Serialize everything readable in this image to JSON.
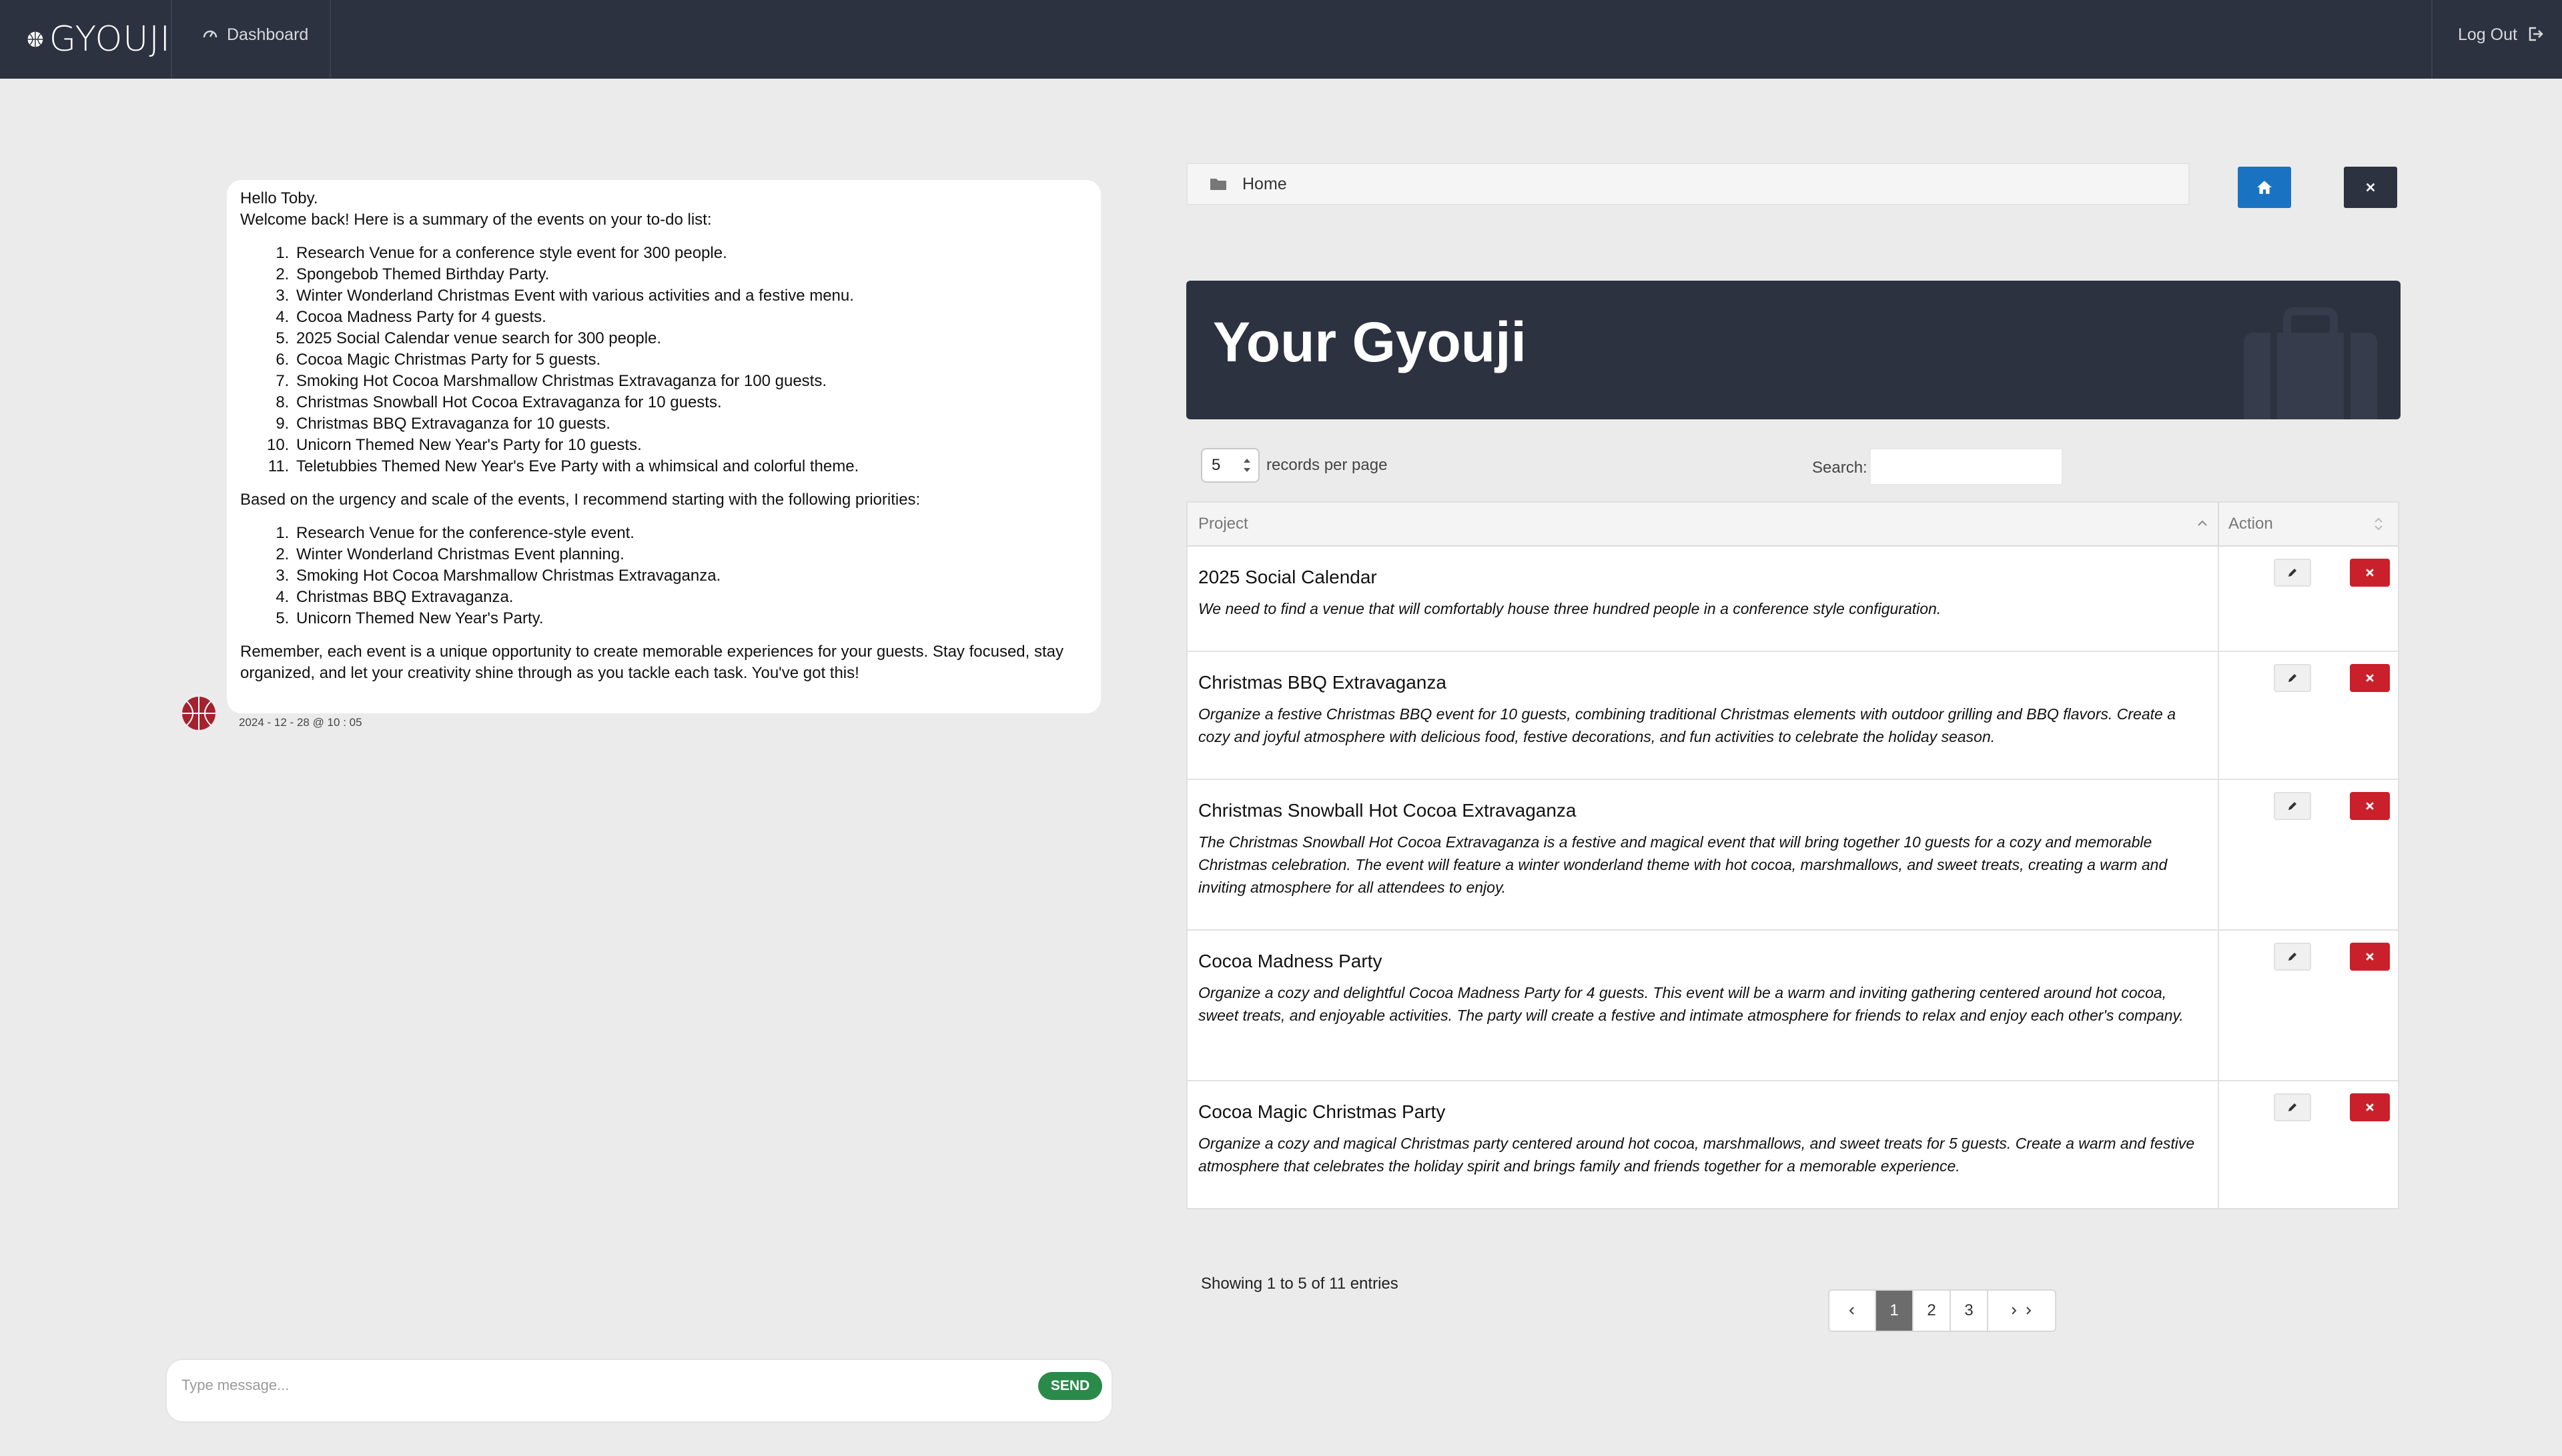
{
  "nav": {
    "brand": "GYOUJI",
    "dashboard_label": "Dashboard",
    "logout_label": "Log Out",
    "bg_color": "#2d3240"
  },
  "chat": {
    "greeting": "Hello Toby.",
    "intro": "Welcome back! Here is a summary of the events on your to-do list:",
    "todo": [
      "Research Venue for a conference style event for 300 people.",
      "Spongebob Themed Birthday Party.",
      "Winter Wonderland Christmas Event with various activities and a festive menu.",
      "Cocoa Madness Party for 4 guests.",
      "2025 Social Calendar venue search for 300 people.",
      "Cocoa Magic Christmas Party for 5 guests.",
      "Smoking Hot Cocoa Marshmallow Christmas Extravaganza for 100 guests.",
      "Christmas Snowball Hot Cocoa Extravaganza for 10 guests.",
      "Christmas BBQ Extravaganza for 10 guests.",
      "Unicorn Themed New Year's Party for 10 guests.",
      "Teletubbies Themed New Year's Eve Party with a whimsical and colorful theme."
    ],
    "priorities_intro": "Based on the urgency and scale of the events, I recommend starting with the following priorities:",
    "priorities": [
      "Research Venue for the conference-style event.",
      "Winter Wonderland Christmas Event planning.",
      "Smoking Hot Cocoa Marshmallow Christmas Extravaganza.",
      "Christmas BBQ Extravaganza.",
      "Unicorn Themed New Year's Party."
    ],
    "closing": "Remember, each event is a unique opportunity to create memorable experiences for your guests. Stay focused, stay organized, and let your creativity shine through as you tackle each task. You've got this!",
    "timestamp": "2024 - 12 - 28 @ 10 : 05",
    "input_placeholder": "Type message...",
    "send_label": "SEND",
    "send_color": "#2a8a4a"
  },
  "breadcrumb": {
    "home_label": "Home"
  },
  "hero": {
    "title": "Your Gyouji"
  },
  "table_controls": {
    "per_page_value": "5",
    "per_page_label": "records per page",
    "search_label": "Search:"
  },
  "table": {
    "headers": {
      "project": "Project",
      "action": "Action"
    },
    "rows": [
      {
        "title": "2025 Social Calendar",
        "description": "We need to find a venue that will comfortably house three hundred people in a conference style configuration."
      },
      {
        "title": "Christmas BBQ Extravaganza",
        "description": "Organize a festive Christmas BBQ event for 10 guests, combining traditional Christmas elements with outdoor grilling and BBQ flavors. Create a cozy and joyful atmosphere with delicious food, festive decorations, and fun activities to celebrate the holiday season."
      },
      {
        "title": "Christmas Snowball Hot Cocoa Extravaganza",
        "description": "The Christmas Snowball Hot Cocoa Extravaganza is a festive and magical event that will bring together 10 guests for a cozy and memorable Christmas celebration. The event will feature a winter wonderland theme with hot cocoa, marshmallows, and sweet treats, creating a warm and inviting atmosphere for all attendees to enjoy."
      },
      {
        "title": "Cocoa Madness Party",
        "description": "Organize a cozy and delightful Cocoa Madness Party for 4 guests. This event will be a warm and inviting gathering centered around hot cocoa, sweet treats, and enjoyable activities. The party will create a festive and intimate atmosphere for friends to relax and enjoy each other's company."
      },
      {
        "title": "Cocoa Magic Christmas Party",
        "description": "Organize a cozy and magical Christmas party centered around hot cocoa, marshmallows, and sweet treats for 5 guests. Create a warm and festive atmosphere that celebrates the holiday spirit and brings family and friends together for a memorable experience."
      }
    ],
    "delete_color": "#c9202c"
  },
  "footer": {
    "showing": "Showing 1 to 5 of 11 entries",
    "pages": [
      "1",
      "2",
      "3"
    ],
    "active_page": "1"
  }
}
